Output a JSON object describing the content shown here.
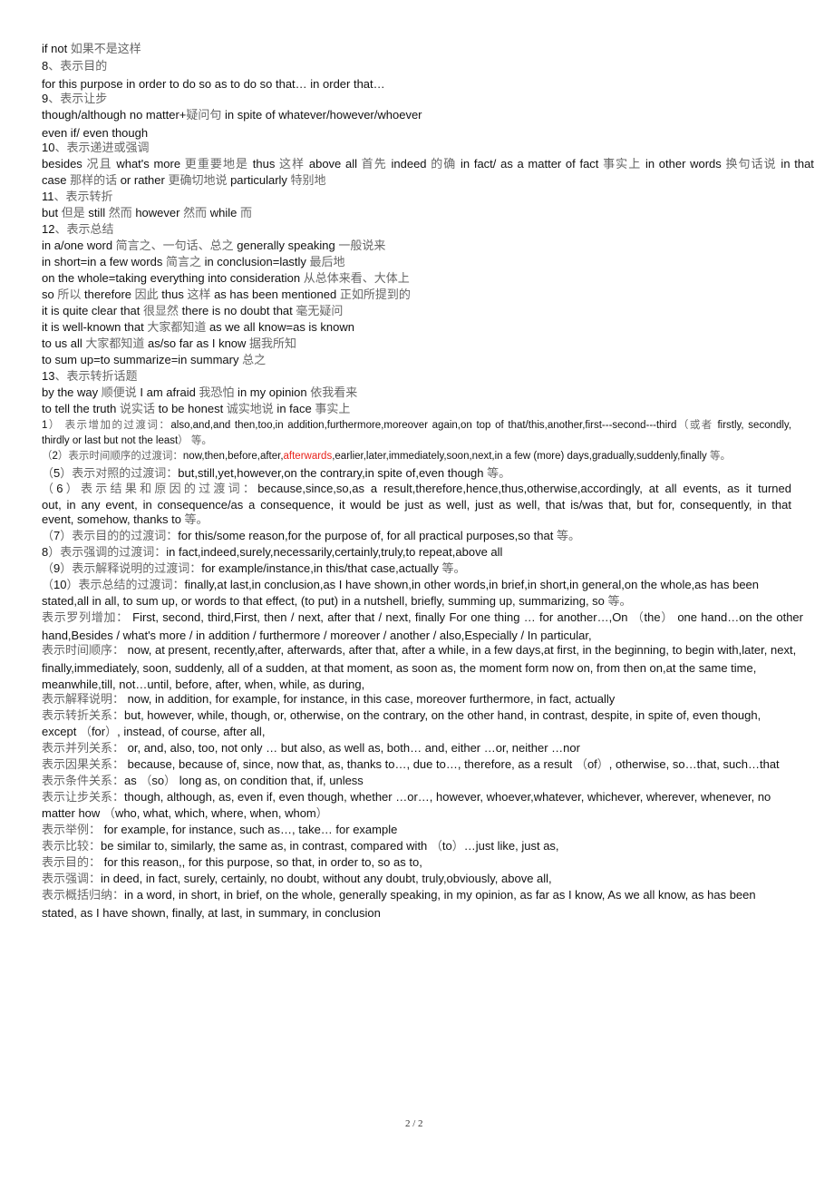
{
  "lines": [
    "if not  如果不是这样",
    "8、表示目的",
    "for this purpose    in order to do    so as to do    so that…      in order that…",
    "9、表示让步",
    "though/although    no matter+疑问句    in spite of    whatever/however/whoever",
    "even if/ even though",
    "10、表示递进或强调",
    "besides  况且  what's more  更重要地是  thus  这样  above all  首先  indeed  的确  in fact/ as a matter of fact  事实上  in other words  换句话说  in that",
    "case  那样的话  or rather  更确切地说  particularly  特别地",
    "11、表示转折",
    "but  但是  still  然而  however  然而  while  而",
    "12、表示总结",
    "in a/one word  简言之、一句话、总之  generally speaking  一般说来",
    "in short=in a few words  简言之  in conclusion=lastly  最后地",
    "on the whole=taking everything into consideration  从总体来看、大体上",
    "so  所以  therefore  因此  thus  这样  as has been mentioned  正如所提到的",
    "it is quite clear that  很显然  there is no doubt that  毫无疑问",
    "it is well-known that  大家都知道  as we all know=as is known",
    "to us all  大家都知道  as/so far as I know  据我所知",
    "to sum up=to summarize=in summary  总之",
    "13、表示转折话题",
    "by the way  顺便说  I am afraid  我恐怕  in my opinion  依我看来",
    "to tell the truth  说实话  to be honest  诚实地说  in face  事实上",
    "1）     表示增加的过渡词：also,and,and then,too,in addition,furthermore,moreover again,on top of that/this,another,first---second---third（或者 firstly, secondly,",
    "thirdly or last but not the least） 等。",
    "（5）表示对照的过渡词：but,still,yet,however,on the contrary,in spite of,even though 等。",
    "（6）表示结果和原因的过渡词：because,since,so,as a result,therefore,hence,thus,otherwise,accordingly, at all events, as it turned",
    "out, in any event, in consequence/as a consequence, it would be just as well, just as well, that is/was that, but for, consequently, in that",
    "event, somehow, thanks to 等。",
    "（7）表示目的的过渡词：for this/some reason,for the purpose of, for all practical purposes,so that 等。",
    "8）表示强调的过渡词：in fact,indeed,surely,necessarily,certainly,truly,to repeat,above all",
    "（9）表示解释说明的过渡词：for example/instance,in this/that case,actually 等。",
    "（10）表示总结的过渡词：finally,at last,in conclusion,as I have shown,in other words,in brief,in short,in general,on the whole,as has been",
    "stated,all in all, to sum up, or words to that effect, (to put) in a nutshell, briefly, summing up, summarizing, so 等。",
    "表示罗列增加：  First, second, third,First, then / next, after that / next, finally For one thing  …  for another…,On  （the）  one hand…on the other",
    "hand,Besides / what's more / in addition / furthermore / moreover / another / also,Especially / In particular,",
    "  表示时间顺序：  now, at present, recently,after, afterwards, after that, after a while, in a few days,at first, in the beginning, to begin with,later, next,",
    "finally,immediately, soon, suddenly, all of a sudden, at that moment, as soon as, the moment form now on, from then on,at the same time,",
    "meanwhile,till, not…until, before, after, when, while, as during,",
    "表示解释说明：  now, in addition, for example, for instance, in this case, moreover furthermore, in fact, actually",
    "  表示转折关系：but, however, while, though, or, otherwise, on the contrary, on the other hand, in contrast, despite, in spite of, even though,",
    "except  （for）, instead, of course, after all,",
    "表示并列关系：  or, and, also, too, not only  …  but also, as well as, both…  and, either  …or, neither  …nor",
    "表示因果关系：  because, because of, since, now that, as, thanks to…, due to…, therefore, as a result  （of）, otherwise, so…that, such…that",
    "  表示条件关系：as  （so）  long as, on condition that, if, unless",
    "表示让步关系：though, although, as, even if, even though, whether  …or…, however, whoever,whatever, whichever, wherever, whenever, no",
    "matter how  （who, what, which, where, when, whom）",
    "表示举例：  for example, for instance, such as…, take…  for example",
    "  表示比较：be similar to, similarly, the same as, in contrast, compared with  （to）…just like, just as,",
    "表示目的：  for this reason,, for this purpose, so that, in order to, so as to,",
    "  表示强调：in deed, in fact, surely, certainly, no doubt, without any doubt, truly,obviously, above all,",
    "表示概括归纳：in a word, in short, in brief, on the whole, generally speaking, in my opinion, as far as I know, As we all know, as has been",
    "stated, as I have shown, finally, at last, in summary, in conclusion"
  ],
  "time_line": {
    "before": "（2）表示时间顺序的过渡词：now,then,before,after,",
    "highlight": "afterwards",
    "after": ",earlier,later,immediately,soon,next,in a few (more) days,gradually,suddenly,finally 等。"
  },
  "highlight_color": "#e8221b",
  "footer": {
    "page": "2 / 2"
  }
}
